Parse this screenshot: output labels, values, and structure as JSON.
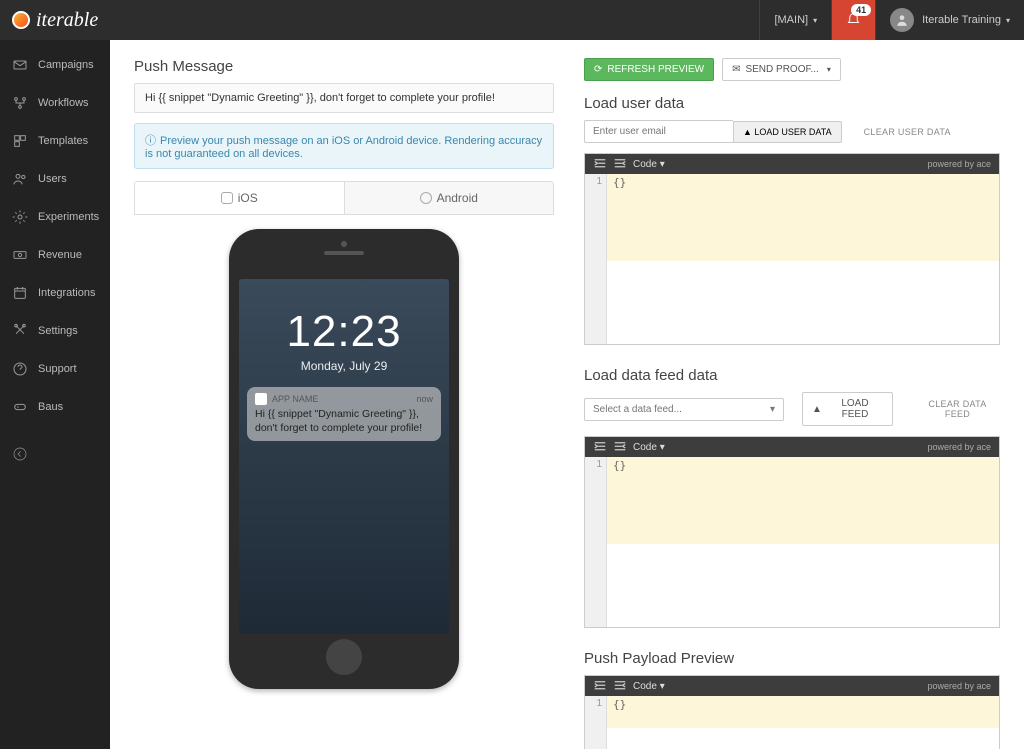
{
  "brand": "iterable",
  "topbar": {
    "main_label": "[MAIN]",
    "bell_count": "41",
    "user_name": "Iterable Training"
  },
  "sidebar": {
    "items": [
      {
        "label": "Campaigns"
      },
      {
        "label": "Workflows"
      },
      {
        "label": "Templates"
      },
      {
        "label": "Users"
      },
      {
        "label": "Experiments"
      },
      {
        "label": "Revenue"
      },
      {
        "label": "Integrations"
      },
      {
        "label": "Settings"
      },
      {
        "label": "Support"
      },
      {
        "label": "Baus"
      }
    ]
  },
  "left": {
    "title": "Push Message",
    "message_text": "Hi {{ snippet \"Dynamic Greeting\" }}, don't forget to complete your profile!",
    "info_text": "Preview your push message on an iOS or Android device. Rendering accuracy is not guaranteed on all devices.",
    "tab_ios": "iOS",
    "tab_android": "Android",
    "phone": {
      "time": "12:23",
      "date": "Monday, July 29",
      "app_name": "APP NAME",
      "notif_time": "now",
      "notif_body": "Hi {{ snippet \"Dynamic Greeting\" }}, don't forget to complete your profile!"
    }
  },
  "right": {
    "refresh_btn": "REFRESH PREVIEW",
    "send_proof_btn": "SEND PROOF...",
    "user_section_title": "Load user data",
    "user_placeholder": "Enter user email",
    "load_user_btn": "LOAD USER DATA",
    "clear_user_btn": "CLEAR USER DATA",
    "feed_section_title": "Load data feed data",
    "feed_placeholder": "Select a data feed...",
    "load_feed_btn": "LOAD FEED",
    "clear_feed_btn": "CLEAR DATA FEED",
    "payload_title": "Push Payload Preview",
    "code_label": "Code",
    "powered": "powered by ace",
    "code_content": "{}",
    "line_no": "1"
  }
}
